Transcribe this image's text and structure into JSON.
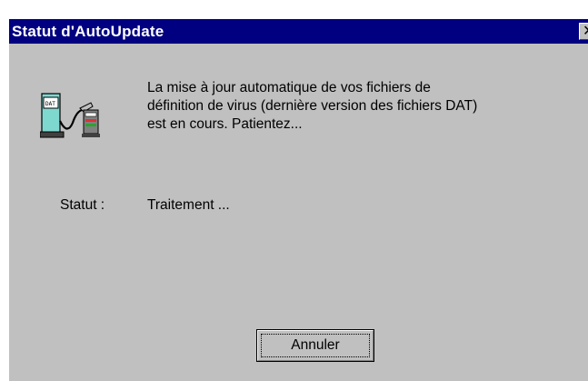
{
  "window": {
    "title": "Statut d'AutoUpdate",
    "close_symbol": "✕"
  },
  "icon": "gas-pump-update-icon",
  "message": {
    "line1": "La mise à jour automatique de vos fichiers de",
    "line2": "définition de virus (dernière version des fichiers DAT)",
    "line3": "est en cours. Patientez..."
  },
  "status": {
    "label": "Statut :",
    "value": "Traitement ..."
  },
  "buttons": {
    "cancel": "Annuler"
  },
  "colors": {
    "titlebar": "#000080",
    "window_bg": "#c0c0c0",
    "pump": "#7fd8d0"
  }
}
